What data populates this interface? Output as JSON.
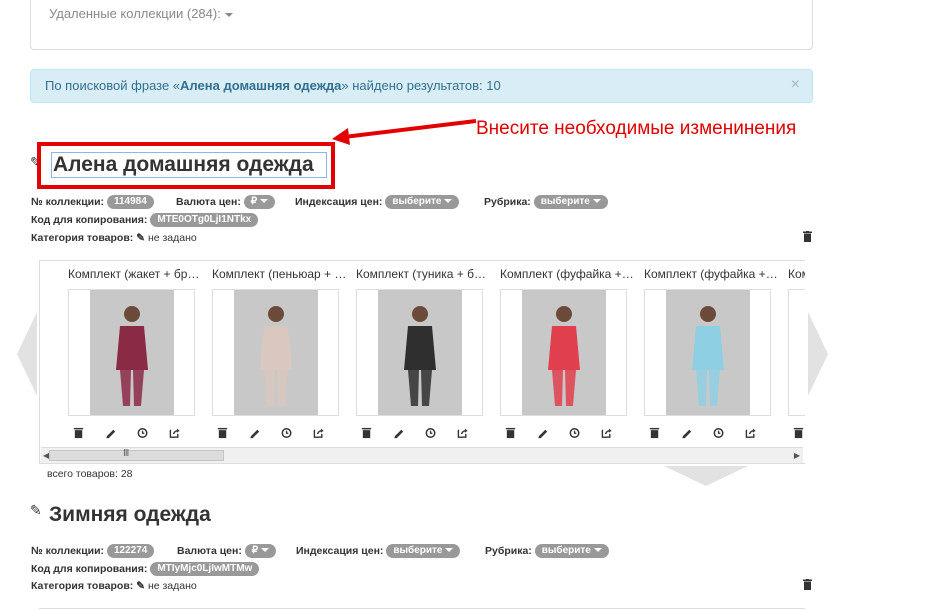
{
  "deleted": {
    "label": "Удаленные коллекции (284):"
  },
  "alert": {
    "prefix": "По поисковой фразе «",
    "phrase": "Алена домашняя одежда",
    "suffix": "» найдено результатов: 10",
    "close": "×"
  },
  "hint": "Внесите необходимые изменинения",
  "collections": [
    {
      "title": "Алена домашняя одежда",
      "number_label": "№ коллекции:",
      "number": "114984",
      "currency_label": "Валюта цен:",
      "currency": "₽",
      "indexation_label": "Индексация цен:",
      "indexation": "выберите",
      "rubric_label": "Рубрика:",
      "rubric": "выберите",
      "code_label": "Код для копирования:",
      "code": "MTE0OTg0LjI1NTkx",
      "category_label": "Категория товаров:",
      "category": "не задано",
      "total": "всего товаров: 28",
      "products": [
        {
          "title": "Комплект (жакет + брюки)",
          "color": "#8a2a45"
        },
        {
          "title": "Комплект (пеньюар + сорочка)",
          "color": "#d9c7c0"
        },
        {
          "title": "Комплект (туника + брюки)",
          "color": "#2f2f2f"
        },
        {
          "title": "Комплект (фуфайка + бриджи)",
          "color": "#e0404e"
        },
        {
          "title": "Комплект (фуфайка + бриджи)",
          "color": "#8ecfe4"
        },
        {
          "title": "Комплект",
          "color": "#cccccc"
        }
      ]
    },
    {
      "title": "Зимняя одежда",
      "number_label": "№ коллекции:",
      "number": "122274",
      "currency_label": "Валюта цен:",
      "currency": "₽",
      "indexation_label": "Индексация цен:",
      "indexation": "выберите",
      "rubric_label": "Рубрика:",
      "rubric": "выберите",
      "code_label": "Код для копирования:",
      "code": "MTIyMjc0LjIwMTMw",
      "category_label": "Категория товаров:",
      "category": "не задано"
    }
  ],
  "scrollbar_grip": "III",
  "colors": {
    "accent_red": "#e30000",
    "alert_bg": "#d9edf7",
    "badge": "#999999"
  }
}
